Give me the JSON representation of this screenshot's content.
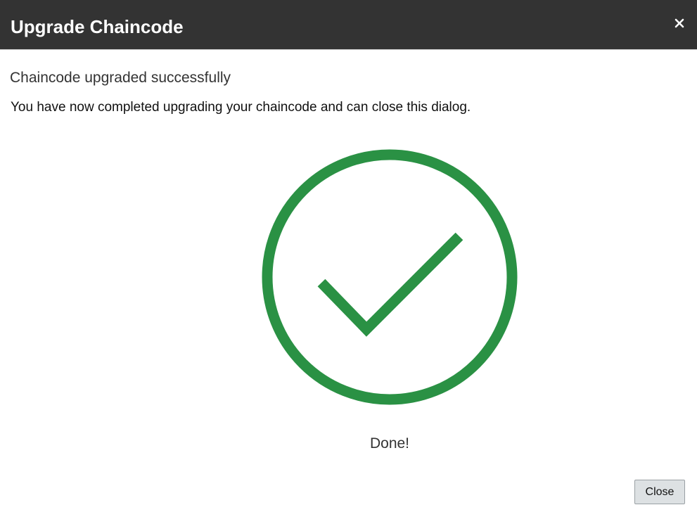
{
  "dialog": {
    "title": "Upgrade Chaincode",
    "close_icon": "close-icon",
    "subtitle": "Chaincode upgraded successfully",
    "message": "You have now completed upgrading your chaincode and can close this dialog.",
    "status_icon": "success-checkmark-icon",
    "status_text": "Done!",
    "close_button_label": "Close"
  },
  "colors": {
    "header_bg": "#333333",
    "success_green": "#2a9144",
    "button_bg": "#dde1e3"
  }
}
